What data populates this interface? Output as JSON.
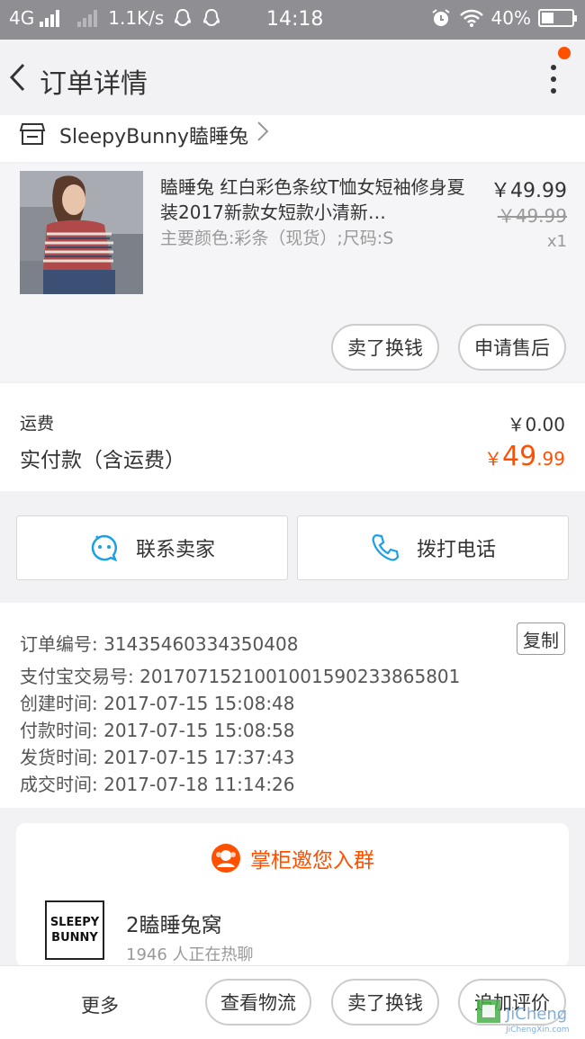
{
  "status_bar": {
    "network": "4G",
    "speed": "1.1K/s",
    "time": "14:18",
    "battery": "40%",
    "battery_level": 0.4
  },
  "nav": {
    "title": "订单详情",
    "accent_color": "#ff5000"
  },
  "shop": {
    "name": "SleepyBunny瞌睡兔"
  },
  "item": {
    "title": "瞌睡兔 红白彩色条纹T恤女短袖修身夏装2017新款女短款小清新…",
    "spec": "主要颜色:彩条（现货）;尺码:S",
    "price": "￥49.99",
    "original_price": "￥49.99",
    "quantity": "x1",
    "actions": [
      "卖了换钱",
      "申请售后"
    ]
  },
  "fees": {
    "shipping_label": "运费",
    "shipping_value": "￥0.00",
    "paid_label": "实付款（含运费）",
    "paid_currency": "￥",
    "paid_int": "49",
    "paid_dec": ".99"
  },
  "contact": {
    "seller": "联系卖家",
    "phone": "拨打电话"
  },
  "order_info": {
    "order_no": "订单编号: 31435460334350408",
    "copy": "复制",
    "alipay_no": "支付宝交易号: 2017071521001001590233865801",
    "created": "创建时间: 2017-07-15 15:08:48",
    "paid": "付款时间: 2017-07-15 15:08:58",
    "shipped": "发货时间: 2017-07-15 17:37:43",
    "completed": "成交时间: 2017-07-18 11:14:26"
  },
  "group": {
    "header": "掌柜邀您入群",
    "logo_line1": "SLEEPY",
    "logo_line2": "BUNNY",
    "name": "2瞌睡兔窝",
    "members": "1946 人正在热聊"
  },
  "bottom_bar": {
    "more": "更多",
    "logistics": "查看物流",
    "sell": "卖了换钱",
    "review": "追加评价"
  },
  "watermark": {
    "text": "JiCheng",
    "domain": "JiChengXin.com"
  }
}
